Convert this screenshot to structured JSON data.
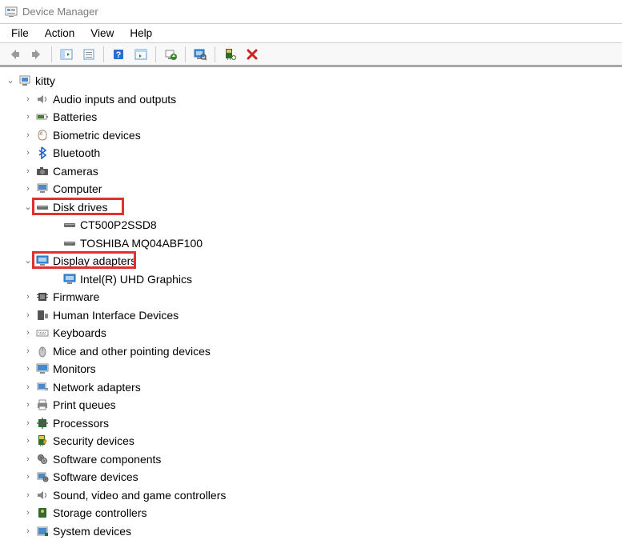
{
  "window": {
    "title": "Device Manager"
  },
  "menu": {
    "file": "File",
    "action": "Action",
    "view": "View",
    "help": "Help"
  },
  "root": {
    "name": "kitty"
  },
  "categories": [
    {
      "id": "audio",
      "label": "Audio inputs and outputs",
      "expanded": false,
      "icon": "speaker"
    },
    {
      "id": "batteries",
      "label": "Batteries",
      "expanded": false,
      "icon": "battery"
    },
    {
      "id": "biometric",
      "label": "Biometric devices",
      "expanded": false,
      "icon": "fingerprint"
    },
    {
      "id": "bluetooth",
      "label": "Bluetooth",
      "expanded": false,
      "icon": "bluetooth"
    },
    {
      "id": "cameras",
      "label": "Cameras",
      "expanded": false,
      "icon": "camera"
    },
    {
      "id": "computer",
      "label": "Computer",
      "expanded": false,
      "icon": "computer"
    },
    {
      "id": "diskdrives",
      "label": "Disk drives",
      "expanded": true,
      "icon": "disk",
      "highlighted": true,
      "children": [
        {
          "label": "CT500P2SSD8",
          "icon": "disk"
        },
        {
          "label": "TOSHIBA MQ04ABF100",
          "icon": "disk"
        }
      ]
    },
    {
      "id": "display",
      "label": "Display adapters",
      "expanded": true,
      "icon": "display",
      "highlighted": true,
      "children": [
        {
          "label": "Intel(R) UHD Graphics",
          "icon": "display"
        }
      ]
    },
    {
      "id": "firmware",
      "label": "Firmware",
      "expanded": false,
      "icon": "chip"
    },
    {
      "id": "hid",
      "label": "Human Interface Devices",
      "expanded": false,
      "icon": "hid"
    },
    {
      "id": "keyboards",
      "label": "Keyboards",
      "expanded": false,
      "icon": "keyboard"
    },
    {
      "id": "mice",
      "label": "Mice and other pointing devices",
      "expanded": false,
      "icon": "mouse"
    },
    {
      "id": "monitors",
      "label": "Monitors",
      "expanded": false,
      "icon": "monitor"
    },
    {
      "id": "network",
      "label": "Network adapters",
      "expanded": false,
      "icon": "network"
    },
    {
      "id": "printqueues",
      "label": "Print queues",
      "expanded": false,
      "icon": "printer"
    },
    {
      "id": "processors",
      "label": "Processors",
      "expanded": false,
      "icon": "cpu"
    },
    {
      "id": "security",
      "label": "Security devices",
      "expanded": false,
      "icon": "security"
    },
    {
      "id": "softcomp",
      "label": "Software components",
      "expanded": false,
      "icon": "softcomp"
    },
    {
      "id": "softdev",
      "label": "Software devices",
      "expanded": false,
      "icon": "softdev"
    },
    {
      "id": "sound",
      "label": "Sound, video and game controllers",
      "expanded": false,
      "icon": "speaker"
    },
    {
      "id": "storage",
      "label": "Storage controllers",
      "expanded": false,
      "icon": "storage"
    },
    {
      "id": "sysdev",
      "label": "System devices",
      "expanded": false,
      "icon": "system"
    }
  ]
}
